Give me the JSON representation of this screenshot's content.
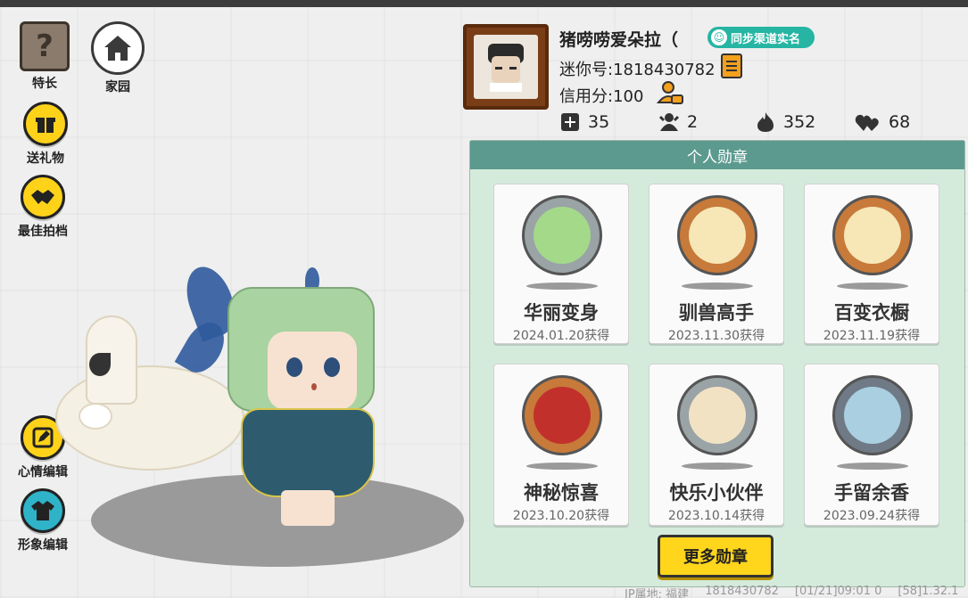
{
  "left_menu": {
    "specialty_label": "特长",
    "home_label": "家园",
    "gift_label": "送礼物",
    "partner_label": "最佳拍档",
    "mood_label": "心情编辑",
    "look_label": "形象编辑"
  },
  "profile": {
    "nickname": "猪唠唠爱朵拉（",
    "sync_label": "同步渠道实名",
    "mini_id_text": "迷你号:1818430782",
    "credit_text": "信用分:100",
    "stats": {
      "plus_count": "35",
      "fans_count": "2",
      "heat_count": "352",
      "likes_count": "68"
    }
  },
  "badges": {
    "title": "个人勋章",
    "items": [
      {
        "name": "华丽变身",
        "date": "2024.01.20获得",
        "ring": "#9aa3a6"
      },
      {
        "name": "驯兽高手",
        "date": "2023.11.30获得",
        "ring": "#c77a3a"
      },
      {
        "name": "百变衣橱",
        "date": "2023.11.19获得",
        "ring": "#c77a3a"
      },
      {
        "name": "神秘惊喜",
        "date": "2023.10.20获得",
        "ring": "#c77a3a"
      },
      {
        "name": "快乐小伙伴",
        "date": "2023.10.14获得",
        "ring": "#9aa3a6"
      },
      {
        "name": "手留余香",
        "date": "2023.09.24获得",
        "ring": "#6f7a86"
      }
    ],
    "more_label": "更多勋章"
  },
  "footer": {
    "ip": "IP属地: 福建",
    "uid": "1818430782",
    "time": "[01/21]09:01 0",
    "version": "[58]1.32.1"
  },
  "colors": {
    "accent_yellow": "#ffd21a",
    "panel_header": "#5c9a8f",
    "panel_bg": "#d4ebdc",
    "sync_teal": "#26b5a3"
  }
}
